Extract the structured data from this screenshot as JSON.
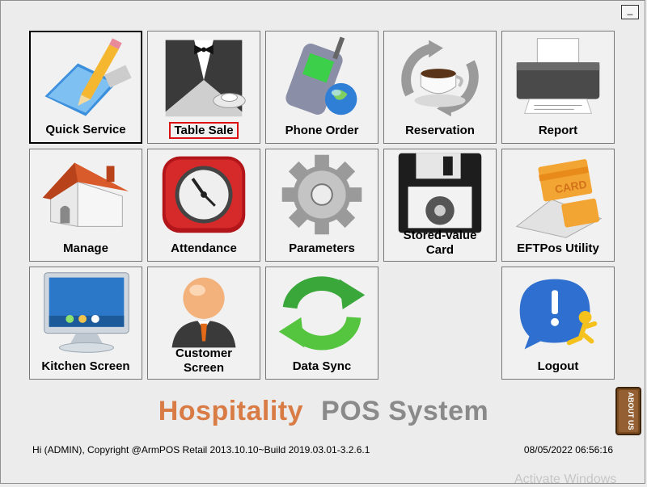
{
  "window": {
    "minimize_label": "_"
  },
  "tiles": [
    {
      "label": "Quick Service",
      "icon": "pencil-icon"
    },
    {
      "label": "Table Sale",
      "icon": "waiter-icon"
    },
    {
      "label": "Phone Order",
      "icon": "phone-globe-icon"
    },
    {
      "label": "Reservation",
      "icon": "coffee-cup-icon"
    },
    {
      "label": "Report",
      "icon": "printer-icon"
    },
    {
      "label": "Manage",
      "icon": "house-icon"
    },
    {
      "label": "Attendance",
      "icon": "clock-icon"
    },
    {
      "label": "Parameters",
      "icon": "gear-icon"
    },
    {
      "label": "Stored-value Card",
      "label_line1": "Stored-value",
      "label_line2": "Card",
      "icon": "floppy-disk-gear-icon"
    },
    {
      "label": "EFTPos Utility",
      "icon": "card-icon",
      "card_text": "CARD"
    },
    {
      "label": "Kitchen Screen",
      "icon": "monitor-icon"
    },
    {
      "label": "Customer Screen",
      "label_line1": "Customer",
      "label_line2": "Screen",
      "icon": "user-icon"
    },
    {
      "label": "Data Sync",
      "icon": "sync-icon"
    },
    {
      "label": "Logout",
      "icon": "logout-icon"
    }
  ],
  "brand": {
    "part1": "Hospitality",
    "part2": "POS System"
  },
  "status": {
    "left": "Hi (ADMIN), Copyright @ArmPOS Retail 2013.10.10~Build 2019.03.01-3.2.6.1",
    "datetime": "08/05/2022 06:56:16"
  },
  "about_label": "ABOUT US",
  "watermark": "Activate Windows",
  "colors": {
    "brand_orange": "#d97b44",
    "brand_gray": "#8a8a8a",
    "highlight_red": "#dd1111"
  }
}
